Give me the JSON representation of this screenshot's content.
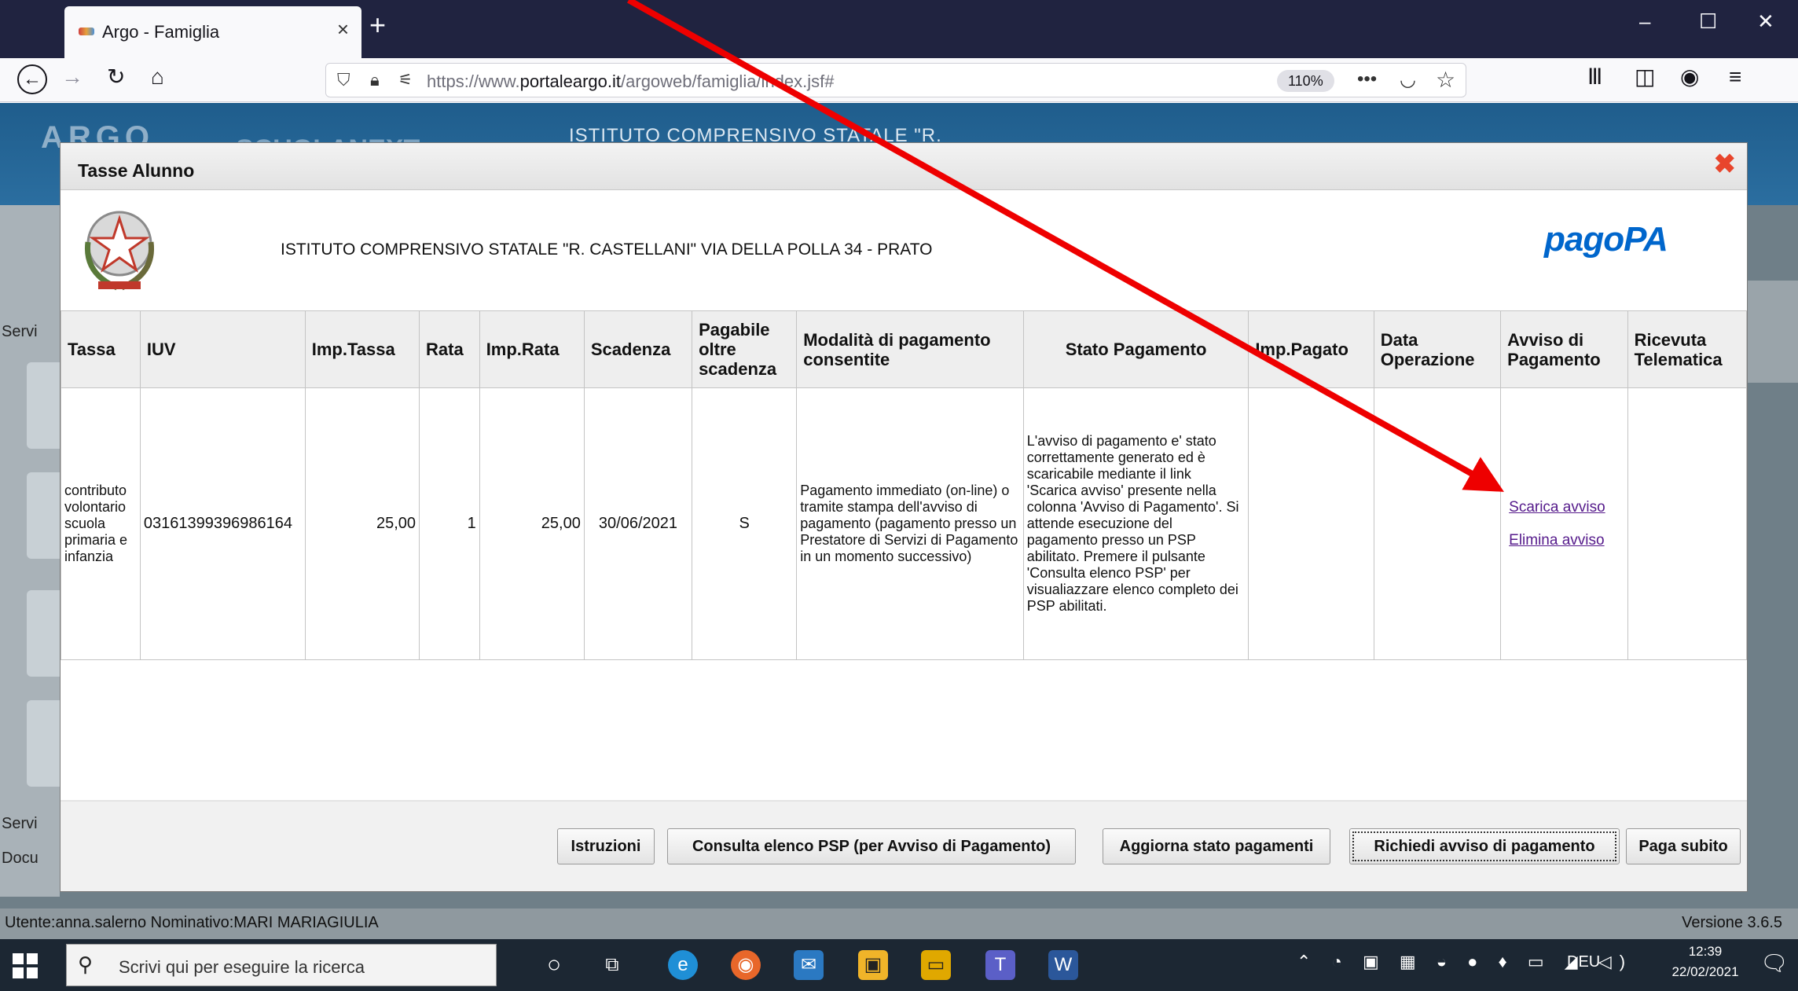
{
  "browser": {
    "tab_title": "Argo - Famiglia",
    "url_prefix": "https://www.",
    "url_domain": "portaleargo.it",
    "url_path": "/argoweb/famiglia/index.jsf#",
    "zoom": "110%"
  },
  "background_page": {
    "logo": "ARGO",
    "product": "SCUOLANEXT",
    "school_header": "ISTITUTO COMPRENSIVO STATALE \"R.",
    "side_labels": [
      "Servi",
      "Servi",
      "Docu"
    ],
    "status_user": "Utente:anna.salerno Nominativo:MARI MARIAGIULIA",
    "status_version": "Versione 3.6.5"
  },
  "modal": {
    "title": "Tasse Alunno",
    "school_name": "ISTITUTO COMPRENSIVO STATALE \"R. CASTELLANI\" VIA DELLA POLLA 34 - PRATO",
    "pagopa_logo": "pagoPA",
    "columns": [
      "Tassa",
      "IUV",
      "Imp.Tassa",
      "Rata",
      "Imp.Rata",
      "Scadenza",
      "Pagabile oltre scadenza",
      "Modalità di pagamento consentite",
      "Stato Pagamento",
      "Imp.Pagato",
      "Data Operazione",
      "Avviso di Pagamento",
      "Ricevuta Telematica"
    ],
    "row": {
      "tassa": "contributo volontario scuola primaria e infanzia",
      "iuv": "03161399396986164",
      "imp_tassa": "25,00",
      "rata": "1",
      "imp_rata": "25,00",
      "scadenza": "30/06/2021",
      "pagabile": "S",
      "modalita": "Pagamento immediato (on-line) o tramite stampa dell'avviso di pagamento (pagamento presso un Prestatore di Servizi di Pagamento in un momento successivo)",
      "stato": "L'avviso di pagamento e' stato correttamente generato ed è scaricabile mediante il link 'Scarica avviso' presente nella colonna 'Avviso di Pagamento'. Si attende esecuzione del pagamento presso un PSP abilitato. Premere il pulsante 'Consulta elenco PSP' per visualiazzare elenco completo dei PSP abilitati.",
      "imp_pagato": "",
      "data_operazione": "",
      "link_scarica": "Scarica avviso",
      "link_elimina": "Elimina avviso",
      "ricevuta": ""
    },
    "buttons": {
      "istruzioni": "Istruzioni",
      "psp": "Consulta elenco PSP (per Avviso di Pagamento)",
      "aggiorna": "Aggiorna stato pagamenti",
      "richiedi": "Richiedi avviso di pagamento",
      "paga": "Paga subito"
    }
  },
  "taskbar": {
    "search_placeholder": "Scrivi qui per eseguire la ricerca",
    "language": "DEU",
    "time": "12:39",
    "date": "22/02/2021"
  },
  "annotation": {
    "arrow_color": "#ee0000"
  }
}
